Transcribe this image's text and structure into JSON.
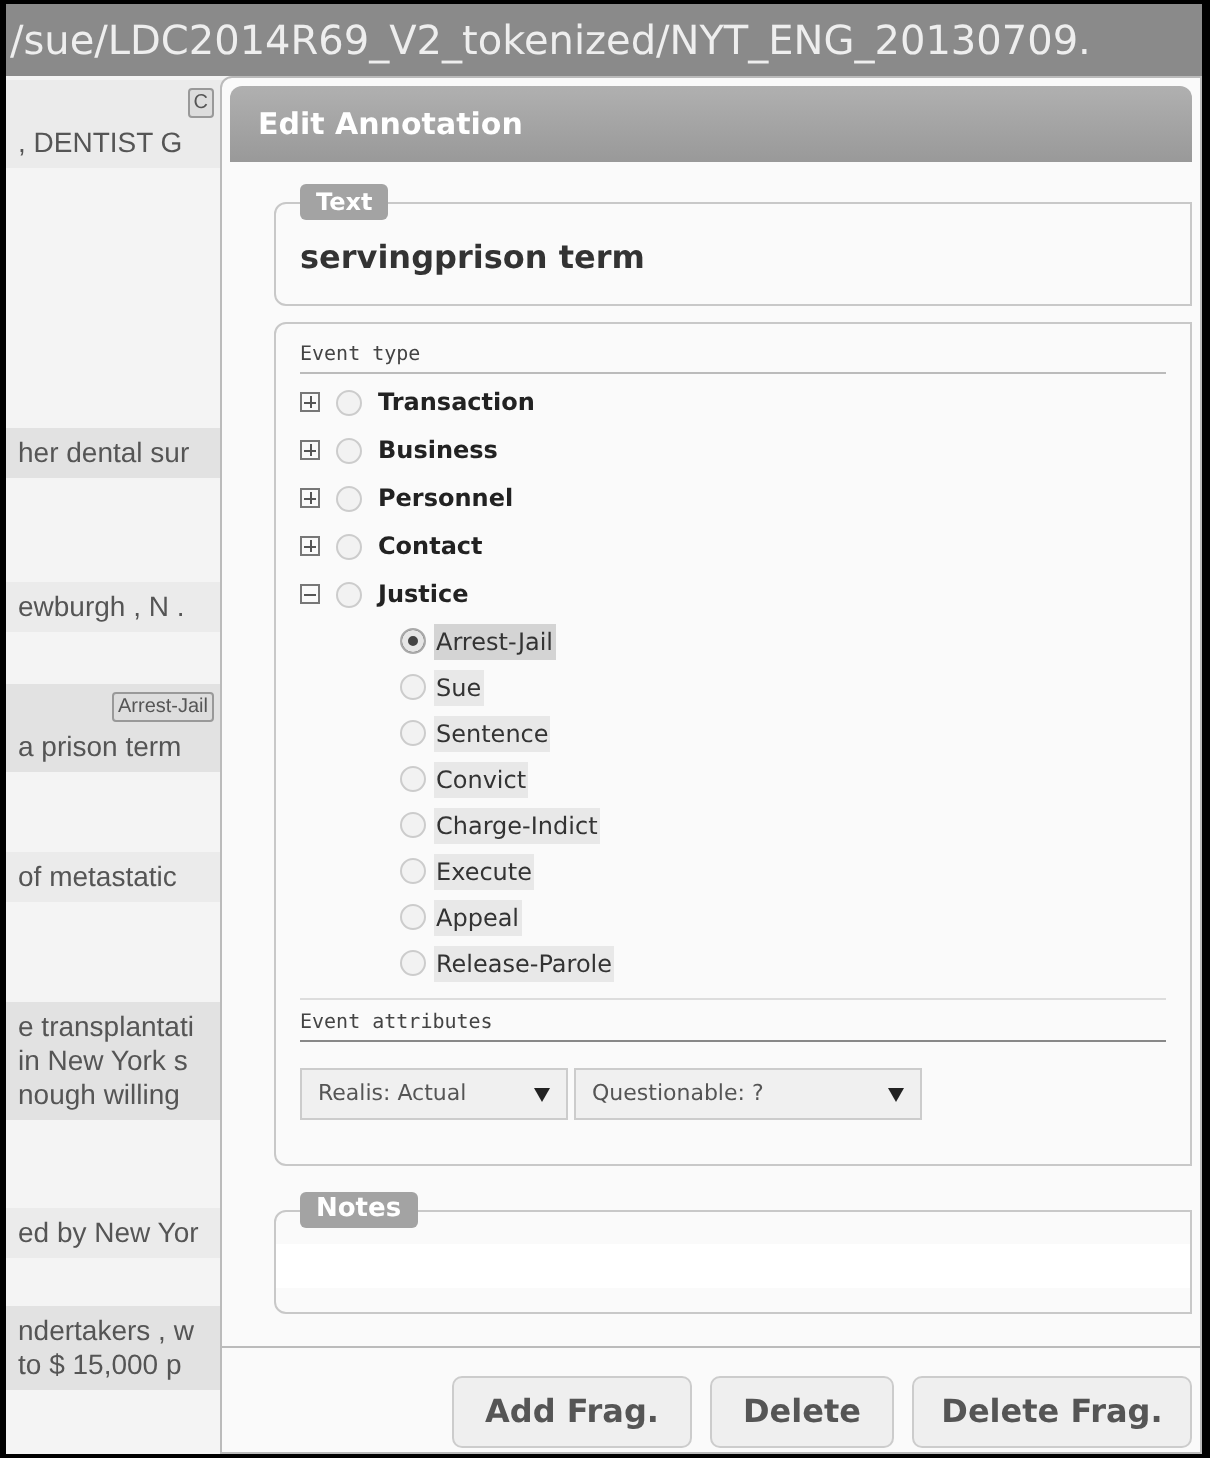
{
  "address_bar": {
    "path": "/sue/LDC2014R69_V2_tokenized/NYT_ENG_20130709."
  },
  "document": [
    {
      "tag": "C",
      "lines": [
        ", DENTIST G"
      ]
    },
    {
      "lines": [
        "her dental sur"
      ]
    },
    {
      "lines": [
        "ewburgh , N ."
      ]
    },
    {
      "tag": "Arrest-Jail",
      "lines": [
        "a prison term"
      ]
    },
    {
      "lines": [
        "of metastatic"
      ]
    },
    {
      "lines": [
        "e transplantati",
        "in New York s",
        "nough willing"
      ]
    },
    {
      "lines": [
        "ed by New Yor"
      ]
    },
    {
      "lines": [
        "ndertakers , w",
        "to $ 15,000 p"
      ]
    }
  ],
  "dialog": {
    "title": "Edit Annotation",
    "text_field": {
      "legend": "Text",
      "value": "servingprison term"
    },
    "event_type": {
      "label": "Event type",
      "items": [
        {
          "label": "Transaction",
          "expanded": false,
          "selected": false
        },
        {
          "label": "Business",
          "expanded": false,
          "selected": false
        },
        {
          "label": "Personnel",
          "expanded": false,
          "selected": false
        },
        {
          "label": "Contact",
          "expanded": false,
          "selected": false
        },
        {
          "label": "Justice",
          "expanded": true,
          "selected": false,
          "children": [
            {
              "label": "Arrest-Jail",
              "selected": true
            },
            {
              "label": "Sue",
              "selected": false
            },
            {
              "label": "Sentence",
              "selected": false
            },
            {
              "label": "Convict",
              "selected": false
            },
            {
              "label": "Charge-Indict",
              "selected": false
            },
            {
              "label": "Execute",
              "selected": false
            },
            {
              "label": "Appeal",
              "selected": false
            },
            {
              "label": "Release-Parole",
              "selected": false
            }
          ]
        }
      ]
    },
    "event_attributes": {
      "label": "Event attributes",
      "selects": [
        {
          "value": "Realis: Actual"
        },
        {
          "value": "Questionable: ?"
        }
      ]
    },
    "notes": {
      "legend": "Notes"
    },
    "buttons": [
      "Add Frag.",
      "Delete",
      "Delete Frag."
    ]
  }
}
